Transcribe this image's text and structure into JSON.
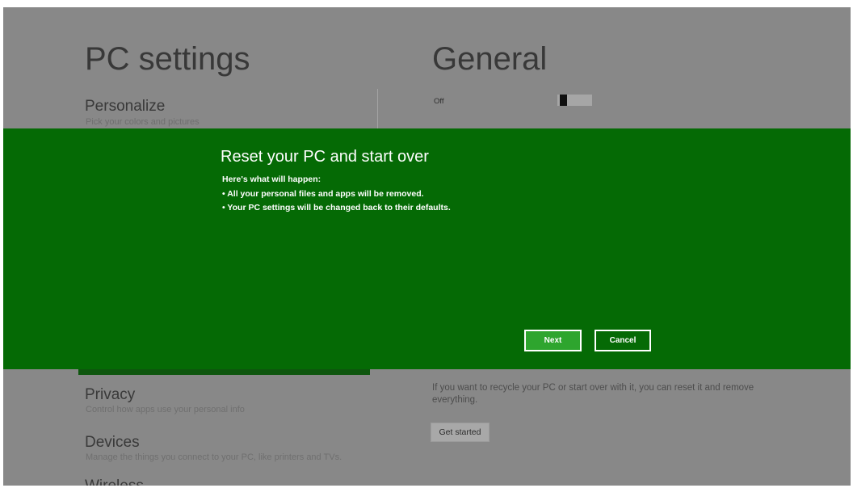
{
  "left_pane": {
    "title": "PC settings",
    "items": [
      {
        "label": "Personalize",
        "description": "Pick your colors and pictures"
      },
      {
        "label": "Privacy",
        "description": "Control how apps use your personal info"
      },
      {
        "label": "Devices",
        "description": "Manage the things you connect to your PC, like printers and TVs."
      },
      {
        "label": "Wireless"
      }
    ]
  },
  "right_pane": {
    "title": "General",
    "toggle": {
      "state_label": "Off",
      "value": false
    },
    "reset_section": {
      "description": "If you want to recycle your PC or start over with it, you can reset it and remove everything.",
      "button_label": "Get started"
    }
  },
  "dialog": {
    "title": "Reset your PC and start over",
    "intro": "Here's what will happen:",
    "bullets": [
      "• All your personal files and apps will be removed.",
      "• Your PC settings will be changed back to their defaults."
    ],
    "buttons": {
      "primary": "Next",
      "secondary": "Cancel"
    }
  },
  "colors": {
    "overlay_background": "#888888",
    "dialog_background": "#056a05",
    "primary_button": "#2ea52e",
    "dialog_text": "#ffffff"
  }
}
